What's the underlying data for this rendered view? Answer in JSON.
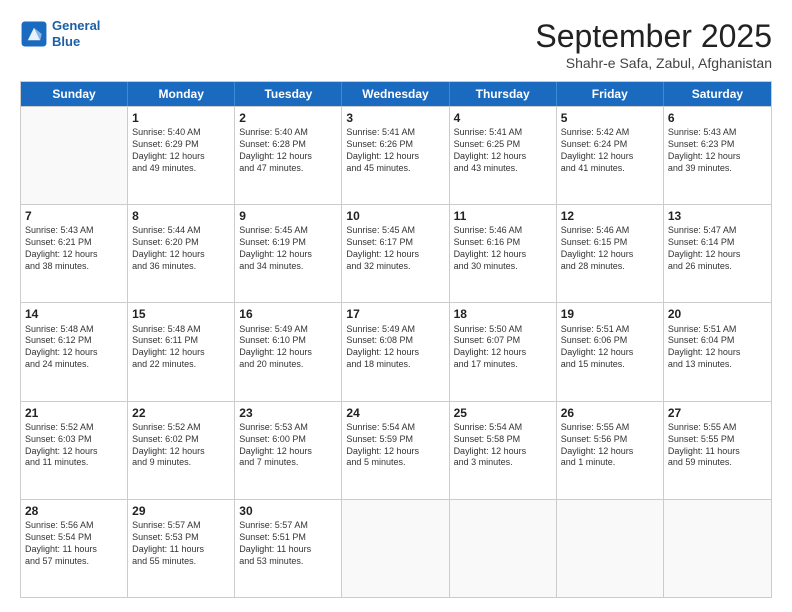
{
  "header": {
    "logo_line1": "General",
    "logo_line2": "Blue",
    "month": "September 2025",
    "location": "Shahr-e Safa, Zabul, Afghanistan"
  },
  "weekdays": [
    "Sunday",
    "Monday",
    "Tuesday",
    "Wednesday",
    "Thursday",
    "Friday",
    "Saturday"
  ],
  "weeks": [
    [
      {
        "day": "",
        "info": ""
      },
      {
        "day": "1",
        "info": "Sunrise: 5:40 AM\nSunset: 6:29 PM\nDaylight: 12 hours\nand 49 minutes."
      },
      {
        "day": "2",
        "info": "Sunrise: 5:40 AM\nSunset: 6:28 PM\nDaylight: 12 hours\nand 47 minutes."
      },
      {
        "day": "3",
        "info": "Sunrise: 5:41 AM\nSunset: 6:26 PM\nDaylight: 12 hours\nand 45 minutes."
      },
      {
        "day": "4",
        "info": "Sunrise: 5:41 AM\nSunset: 6:25 PM\nDaylight: 12 hours\nand 43 minutes."
      },
      {
        "day": "5",
        "info": "Sunrise: 5:42 AM\nSunset: 6:24 PM\nDaylight: 12 hours\nand 41 minutes."
      },
      {
        "day": "6",
        "info": "Sunrise: 5:43 AM\nSunset: 6:23 PM\nDaylight: 12 hours\nand 39 minutes."
      }
    ],
    [
      {
        "day": "7",
        "info": "Sunrise: 5:43 AM\nSunset: 6:21 PM\nDaylight: 12 hours\nand 38 minutes."
      },
      {
        "day": "8",
        "info": "Sunrise: 5:44 AM\nSunset: 6:20 PM\nDaylight: 12 hours\nand 36 minutes."
      },
      {
        "day": "9",
        "info": "Sunrise: 5:45 AM\nSunset: 6:19 PM\nDaylight: 12 hours\nand 34 minutes."
      },
      {
        "day": "10",
        "info": "Sunrise: 5:45 AM\nSunset: 6:17 PM\nDaylight: 12 hours\nand 32 minutes."
      },
      {
        "day": "11",
        "info": "Sunrise: 5:46 AM\nSunset: 6:16 PM\nDaylight: 12 hours\nand 30 minutes."
      },
      {
        "day": "12",
        "info": "Sunrise: 5:46 AM\nSunset: 6:15 PM\nDaylight: 12 hours\nand 28 minutes."
      },
      {
        "day": "13",
        "info": "Sunrise: 5:47 AM\nSunset: 6:14 PM\nDaylight: 12 hours\nand 26 minutes."
      }
    ],
    [
      {
        "day": "14",
        "info": "Sunrise: 5:48 AM\nSunset: 6:12 PM\nDaylight: 12 hours\nand 24 minutes."
      },
      {
        "day": "15",
        "info": "Sunrise: 5:48 AM\nSunset: 6:11 PM\nDaylight: 12 hours\nand 22 minutes."
      },
      {
        "day": "16",
        "info": "Sunrise: 5:49 AM\nSunset: 6:10 PM\nDaylight: 12 hours\nand 20 minutes."
      },
      {
        "day": "17",
        "info": "Sunrise: 5:49 AM\nSunset: 6:08 PM\nDaylight: 12 hours\nand 18 minutes."
      },
      {
        "day": "18",
        "info": "Sunrise: 5:50 AM\nSunset: 6:07 PM\nDaylight: 12 hours\nand 17 minutes."
      },
      {
        "day": "19",
        "info": "Sunrise: 5:51 AM\nSunset: 6:06 PM\nDaylight: 12 hours\nand 15 minutes."
      },
      {
        "day": "20",
        "info": "Sunrise: 5:51 AM\nSunset: 6:04 PM\nDaylight: 12 hours\nand 13 minutes."
      }
    ],
    [
      {
        "day": "21",
        "info": "Sunrise: 5:52 AM\nSunset: 6:03 PM\nDaylight: 12 hours\nand 11 minutes."
      },
      {
        "day": "22",
        "info": "Sunrise: 5:52 AM\nSunset: 6:02 PM\nDaylight: 12 hours\nand 9 minutes."
      },
      {
        "day": "23",
        "info": "Sunrise: 5:53 AM\nSunset: 6:00 PM\nDaylight: 12 hours\nand 7 minutes."
      },
      {
        "day": "24",
        "info": "Sunrise: 5:54 AM\nSunset: 5:59 PM\nDaylight: 12 hours\nand 5 minutes."
      },
      {
        "day": "25",
        "info": "Sunrise: 5:54 AM\nSunset: 5:58 PM\nDaylight: 12 hours\nand 3 minutes."
      },
      {
        "day": "26",
        "info": "Sunrise: 5:55 AM\nSunset: 5:56 PM\nDaylight: 12 hours\nand 1 minute."
      },
      {
        "day": "27",
        "info": "Sunrise: 5:55 AM\nSunset: 5:55 PM\nDaylight: 11 hours\nand 59 minutes."
      }
    ],
    [
      {
        "day": "28",
        "info": "Sunrise: 5:56 AM\nSunset: 5:54 PM\nDaylight: 11 hours\nand 57 minutes."
      },
      {
        "day": "29",
        "info": "Sunrise: 5:57 AM\nSunset: 5:53 PM\nDaylight: 11 hours\nand 55 minutes."
      },
      {
        "day": "30",
        "info": "Sunrise: 5:57 AM\nSunset: 5:51 PM\nDaylight: 11 hours\nand 53 minutes."
      },
      {
        "day": "",
        "info": ""
      },
      {
        "day": "",
        "info": ""
      },
      {
        "day": "",
        "info": ""
      },
      {
        "day": "",
        "info": ""
      }
    ]
  ]
}
